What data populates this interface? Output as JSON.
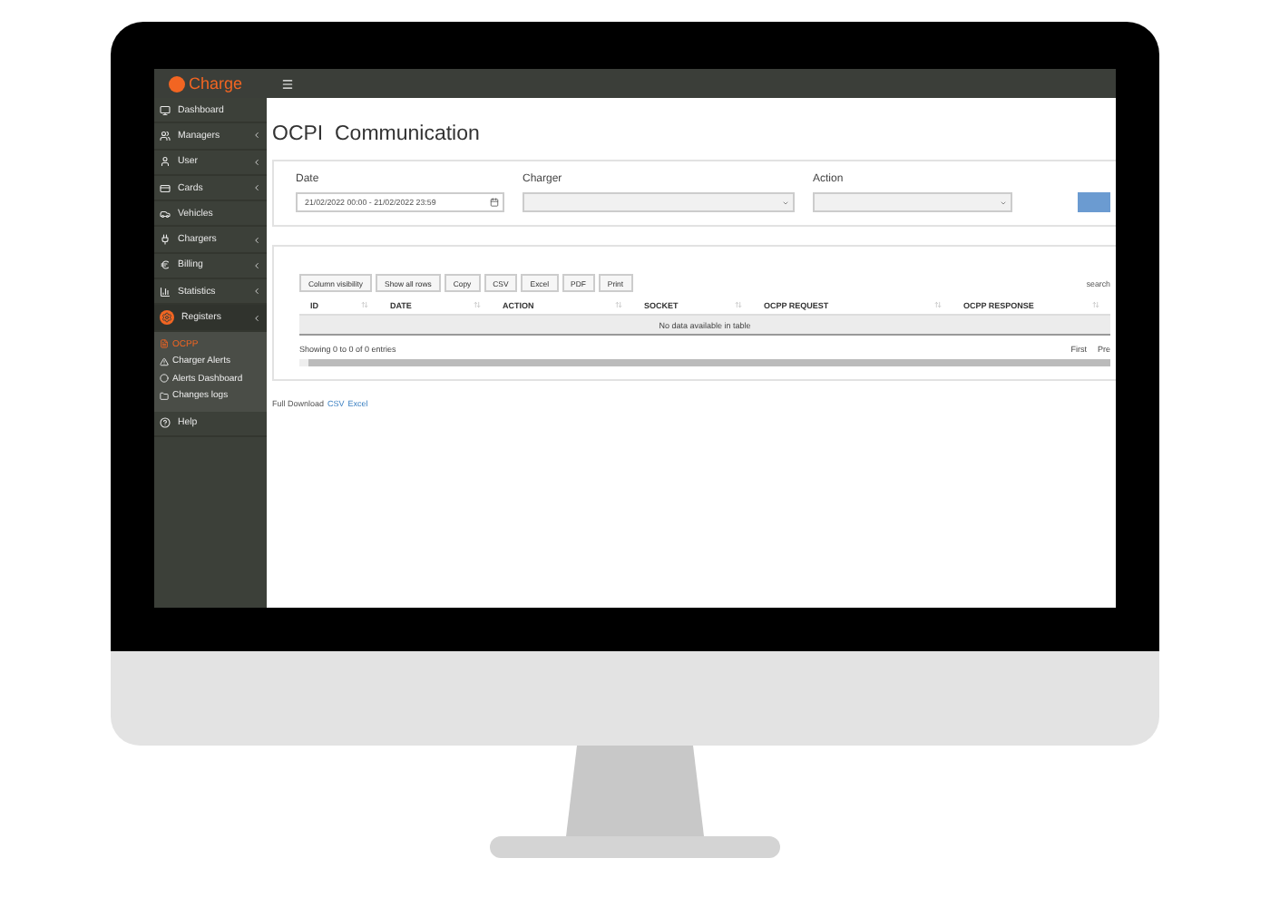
{
  "app": {
    "brand": "Charge"
  },
  "sidebar": {
    "items": [
      {
        "label": "Dashboard",
        "expandable": false,
        "selected": false
      },
      {
        "label": "Managers",
        "expandable": true,
        "selected": false
      },
      {
        "label": "User",
        "expandable": true,
        "selected": false
      },
      {
        "label": "Cards",
        "expandable": true,
        "selected": false
      },
      {
        "label": "Vehicles",
        "expandable": false,
        "selected": false
      },
      {
        "label": "Chargers",
        "expandable": true,
        "selected": false
      },
      {
        "label": "Billing",
        "expandable": true,
        "selected": false
      },
      {
        "label": "Statistics",
        "expandable": true,
        "selected": false
      },
      {
        "label": "Registers",
        "expandable": true,
        "selected": true,
        "expanded": true,
        "children": [
          {
            "label": "OCPP",
            "selected": true
          },
          {
            "label": "Charger Alerts",
            "selected": false
          },
          {
            "label": "Alerts Dashboard",
            "selected": false
          },
          {
            "label": "Changes logs",
            "selected": false
          }
        ]
      },
      {
        "label": "Help",
        "expandable": false,
        "selected": false
      }
    ]
  },
  "page": {
    "title": "OCPI  Communication"
  },
  "filters": [
    {
      "label": "Date",
      "kind": "date",
      "value": "21/02/2022 00:00 - 21/02/2022 23:59"
    },
    {
      "label": "Charger",
      "kind": "select"
    },
    {
      "label": "Action",
      "kind": "select"
    }
  ],
  "table": {
    "buttons": [
      "Column visibility",
      "Show all rows",
      "Copy",
      "CSV",
      "Excel",
      "PDF",
      "Print"
    ],
    "search_label": "search",
    "columns": [
      "ID",
      "DATE",
      "ACTION",
      "SOCKET",
      "OCPP REQUEST",
      "OCPP RESPONSE"
    ],
    "empty_message": "No data available in table",
    "info": "Showing 0 to 0 of 0 entries",
    "pagination": [
      "First",
      "Pre"
    ]
  },
  "footer": {
    "label": "Full Download",
    "links": [
      "CSV",
      "Excel"
    ]
  }
}
